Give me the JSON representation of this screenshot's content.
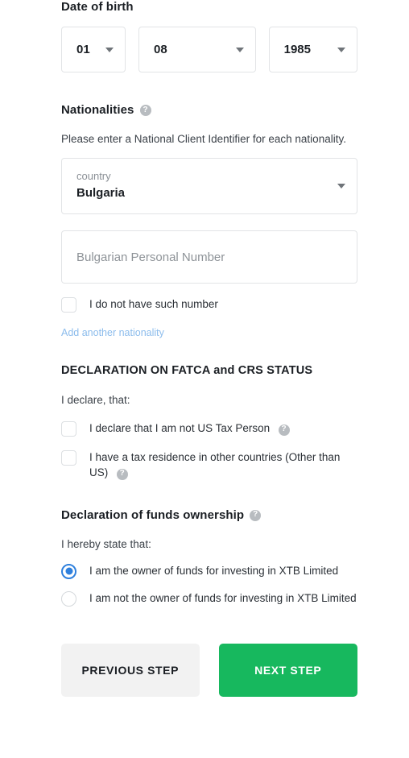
{
  "date_of_birth": {
    "title": "Date of birth",
    "day": "01",
    "month": "08",
    "year": "1985"
  },
  "nationalities": {
    "title": "Nationalities",
    "help_icon": "question-mark-icon",
    "description": "Please enter a National Client Identifier for each nationality.",
    "country_field": {
      "label": "country",
      "value": "Bulgaria"
    },
    "identifier_placeholder": "Bulgarian Personal Number",
    "identifier_value": "",
    "no_number_label": "I do not have such number",
    "add_link": "Add another nationality"
  },
  "fatca": {
    "title": "DECLARATION ON FATCA and CRS STATUS",
    "intro": "I declare, that:",
    "items": [
      {
        "label": "I declare that I am not US Tax Person",
        "has_help": true
      },
      {
        "label": "I have a tax residence in other countries (Other than US)",
        "has_help": true
      }
    ]
  },
  "funds": {
    "title": "Declaration of funds ownership",
    "intro": "I hereby state that:",
    "options": [
      {
        "label": "I am the owner of funds for investing in XTB Limited",
        "selected": true
      },
      {
        "label": "I am not the owner of funds for investing in XTB Limited",
        "selected": false
      }
    ]
  },
  "buttons": {
    "previous": "PREVIOUS STEP",
    "next": "NEXT STEP"
  },
  "colors": {
    "accent_green": "#17b85e",
    "link_blue": "#8cbcec",
    "radio_blue": "#2f80dd",
    "border_grey": "#e2e4e6",
    "help_grey": "#b8bcc0"
  }
}
